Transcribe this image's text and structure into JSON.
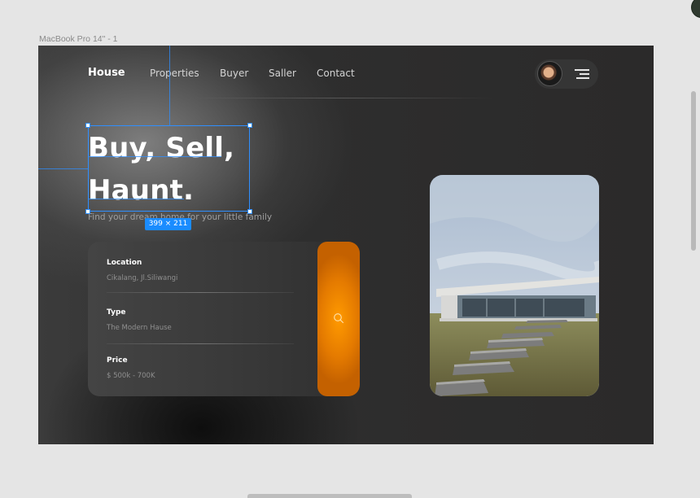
{
  "canvas": {
    "frame_label": "MacBook Pro 14\" - 1",
    "selection_size": "399 × 211"
  },
  "nav": {
    "logo": "House",
    "links": [
      "Properties",
      "Buyer",
      "Saller",
      "Contact"
    ],
    "menu_icon": "menu-icon"
  },
  "hero": {
    "title_line1": "Buy, Sell,",
    "title_line2": "Haunt.",
    "subtitle": "Find your dream home for your little family"
  },
  "search": {
    "fields": [
      {
        "label": "Location",
        "value": "Cikalang, Jl.Siliwangi"
      },
      {
        "label": "Type",
        "value": "The Modern Hause"
      },
      {
        "label": "Price",
        "value": "$ 500k - 700K"
      }
    ],
    "button_icon": "search-icon"
  },
  "colors": {
    "accent": "#F08A00",
    "background": "#2E2E2E",
    "selection": "#2F8FFF"
  }
}
